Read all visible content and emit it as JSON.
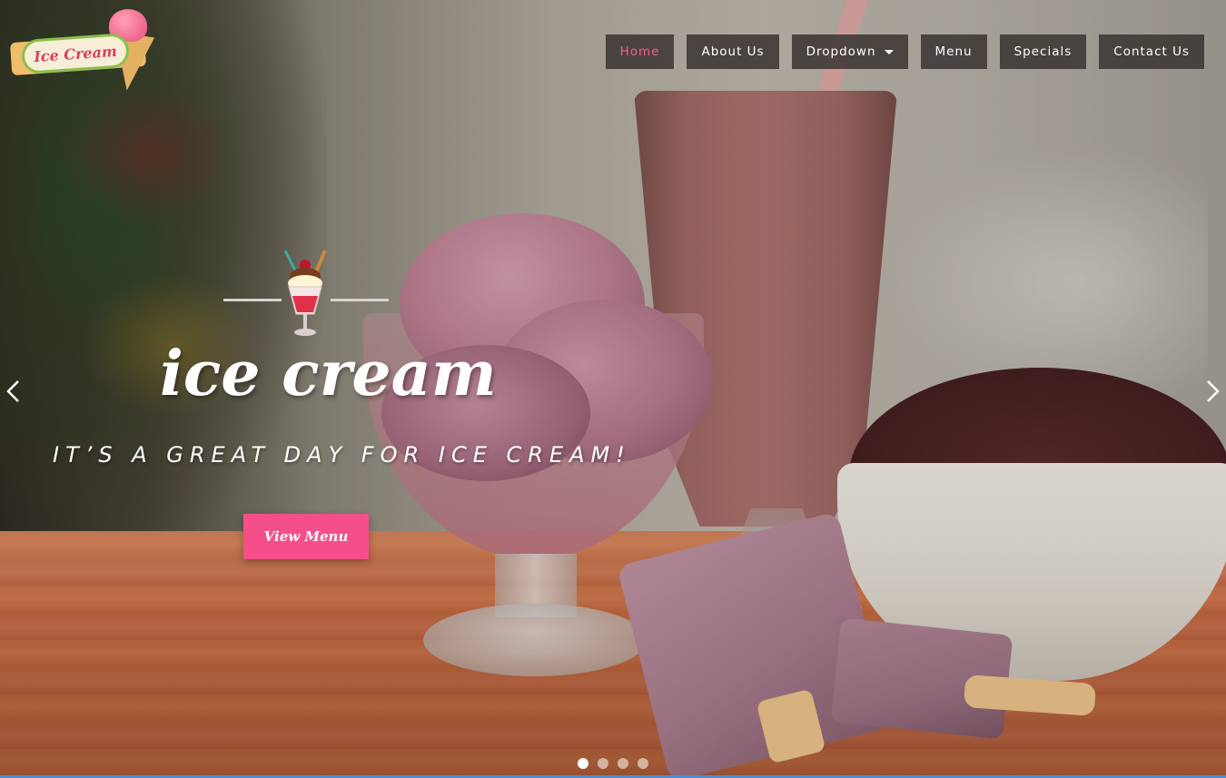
{
  "brand": {
    "logo_text": "Ice Cream",
    "colors": {
      "accent": "#f54f8b",
      "nav_bg": "#3c3734",
      "active_nav": "#f75b8a"
    }
  },
  "nav": {
    "items": [
      {
        "label": "Home",
        "active": true
      },
      {
        "label": "About Us",
        "active": false
      },
      {
        "label": "Dropdown",
        "active": false,
        "has_caret": true
      },
      {
        "label": "Menu",
        "active": false
      },
      {
        "label": "Specials",
        "active": false
      },
      {
        "label": "Contact Us",
        "active": false
      }
    ]
  },
  "hero": {
    "headline": "ice cream",
    "tagline": "IT’S A GREAT DAY FOR ICE CREAM!",
    "button_label": "View Menu",
    "icons": {
      "sundae": "sundae-icon",
      "prev": "chevron-left-icon",
      "next": "chevron-right-icon"
    }
  },
  "carousel": {
    "slide_count": 4,
    "active_slide": 1
  }
}
